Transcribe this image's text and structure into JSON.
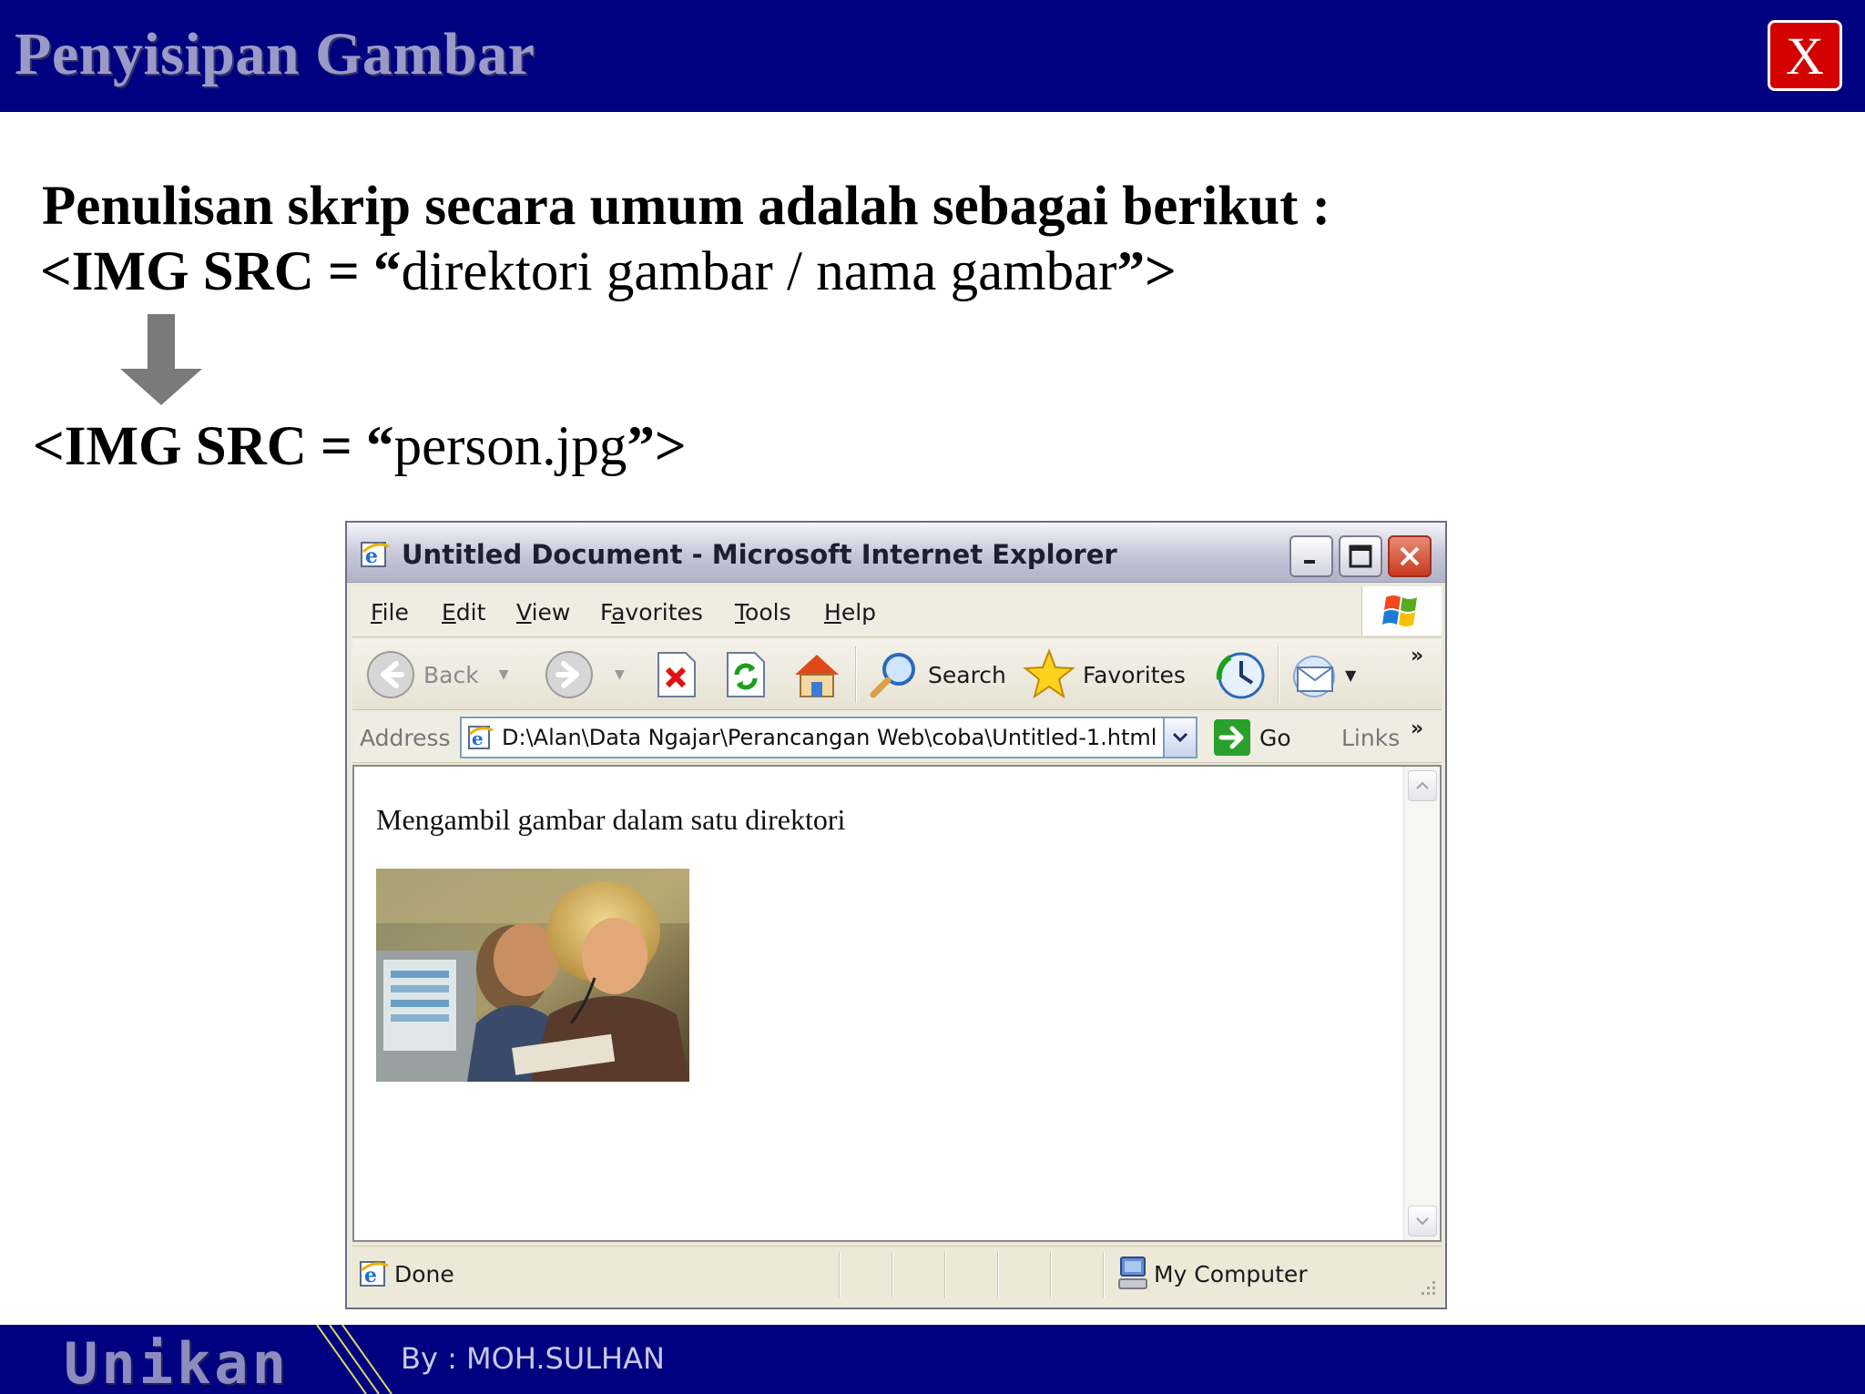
{
  "slide": {
    "title": "Penyisipan Gambar",
    "close_label": "X",
    "line1": "Penulisan skrip secara umum adalah sebagai berikut :",
    "line2_tag": "<IMG SRC = “",
    "line2_value": "direktori gambar / nama gambar",
    "line2_end": "”>",
    "line3_tag": "<IMG SRC = “",
    "line3_value": "person.jpg",
    "line3_end": "”>",
    "footer_brand": "Unikan",
    "footer_author": "By : MOH.SULHAN"
  },
  "browser": {
    "title": "Untitled Document - Microsoft Internet Explorer",
    "menu": [
      {
        "label": "File",
        "key": "F",
        "rest": "ile"
      },
      {
        "label": "Edit",
        "key": "E",
        "rest": "dit"
      },
      {
        "label": "View",
        "key": "V",
        "rest": "iew"
      },
      {
        "label": "Favorites",
        "key": "a",
        "pre": "F",
        "rest": "vorites"
      },
      {
        "label": "Tools",
        "key": "T",
        "rest": "ools"
      },
      {
        "label": "Help",
        "key": "H",
        "rest": "elp"
      }
    ],
    "toolbar": {
      "back": "Back",
      "search": "Search",
      "favorites": "Favorites"
    },
    "address": {
      "label": "Address",
      "value": "D:\\Alan\\Data Ngajar\\Perancangan Web\\coba\\Untitled-1.html",
      "go": "Go",
      "links": "Links"
    },
    "content": {
      "text": "Mengambil gambar dalam satu direktori"
    },
    "status": {
      "text": "Done",
      "zone": "My Computer"
    }
  },
  "colors": {
    "slide_band": "#000080",
    "close_red": "#d40000",
    "title_text": "#9a9ac8"
  },
  "icons": [
    "ie-icon",
    "minimize-icon",
    "maximize-icon",
    "close-icon",
    "windows-logo-icon",
    "back-icon",
    "forward-icon",
    "stop-icon",
    "refresh-icon",
    "home-icon",
    "search-icon",
    "favorites-icon",
    "history-icon",
    "mail-icon",
    "go-arrow-icon",
    "my-computer-icon",
    "down-arrow-icon"
  ]
}
